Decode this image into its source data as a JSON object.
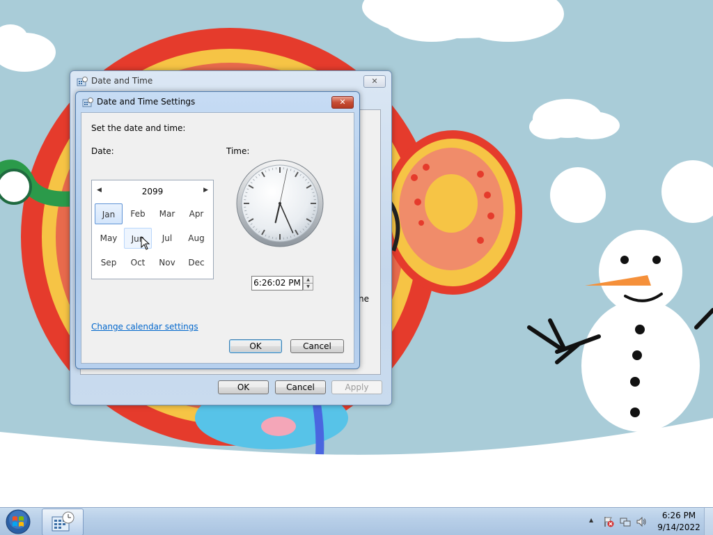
{
  "colors": {
    "sky": "#a9ccd8",
    "snow": "#ffffff",
    "accent_link": "#0066cc",
    "title_active": "#dbe7f4",
    "close_active": "#c74d34"
  },
  "outer_window": {
    "title": "Date and Time",
    "icon": "date-time-icon",
    "close_label": "✕",
    "ok_label": "OK",
    "cancel_label": "Cancel",
    "apply_label": "Apply",
    "partial_text": "ne"
  },
  "dialog": {
    "title": "Date and Time Settings",
    "icon": "date-time-icon",
    "close_label": "✕",
    "instruction": "Set the date and time:",
    "date_label": "Date:",
    "time_label": "Time:",
    "calendar": {
      "year": "2099",
      "prev_icon": "◀",
      "next_icon": "▶",
      "months": [
        "Jan",
        "Feb",
        "Mar",
        "Apr",
        "May",
        "Jun",
        "Jul",
        "Aug",
        "Sep",
        "Oct",
        "Nov",
        "Dec"
      ],
      "selected_month": "Jan",
      "hover_month": "Jun"
    },
    "clock": {
      "hour": 6,
      "minute": 26,
      "second": 2
    },
    "time_value": "6:26:02 PM",
    "spin_up_icon": "▲",
    "spin_down_icon": "▼",
    "change_calendar_link": "Change calendar settings",
    "ok_label": "OK",
    "cancel_label": "Cancel"
  },
  "taskbar": {
    "start_icon": "windows-start-orb",
    "pinned_app_icon": "date-time-icon",
    "tray": {
      "show_hidden_icon": "▲",
      "action_center_icon": "flag-with-x-icon",
      "network_icon": "network-icon",
      "volume_icon": "speaker-icon"
    },
    "clock_time": "6:26 PM",
    "clock_date": "9/14/2022"
  }
}
